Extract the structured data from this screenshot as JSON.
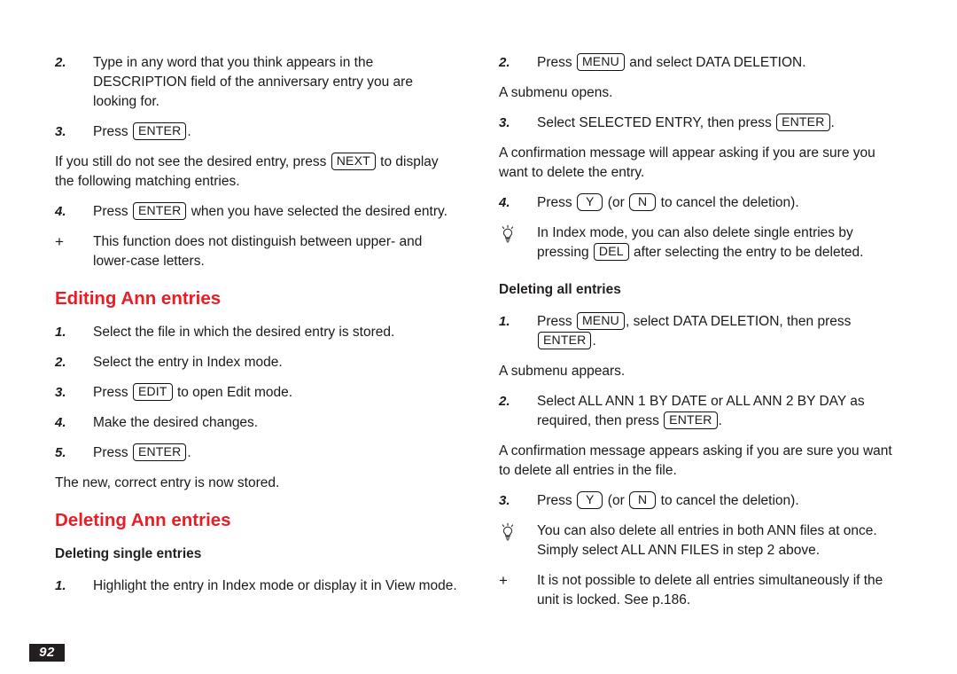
{
  "page": {
    "number": "92",
    "accent_color": "#ec1c24",
    "text_color": "#1a1a1a",
    "background_color": "#ffffff",
    "page_number_box_color": "#231f20"
  },
  "left_column": {
    "step2": {
      "marker": "2.",
      "text": "Type in any word that you think appears in the DESCRIPTION field of the anniversary entry you are looking for."
    },
    "step3": {
      "marker": "3.",
      "before": "Press ",
      "key": "ENTER",
      "after": "."
    },
    "para_next": {
      "before": "If you still do not see the desired entry, press ",
      "key": "NEXT",
      "after": " to display the following matching entries."
    },
    "step4": {
      "marker": "4.",
      "before": "Press ",
      "key": "ENTER",
      "after": " when you have selected the desired entry."
    },
    "note_case": {
      "marker": "+",
      "text": "This function does not distinguish between upper- and lower-case letters."
    },
    "heading_editing": "Editing Ann entries",
    "edit_step1": {
      "marker": "1.",
      "text": "Select the file in which the desired entry is stored."
    },
    "edit_step2": {
      "marker": "2.",
      "text": "Select the entry in Index mode."
    },
    "edit_step3": {
      "marker": "3.",
      "before": "Press ",
      "key": "EDIT",
      "after": " to open Edit mode."
    },
    "edit_step4": {
      "marker": "4.",
      "text": "Make the desired changes."
    },
    "edit_step5": {
      "marker": "5.",
      "before": "Press ",
      "key": "ENTER",
      "after": "."
    },
    "para_stored": "The new, correct entry is now stored.",
    "heading_deleting": "Deleting Ann entries",
    "subheading_single": "Deleting single entries",
    "del_step1": {
      "marker": "1.",
      "text": "Highlight the entry in Index mode or display it in View mode."
    }
  },
  "right_column": {
    "step2": {
      "marker": "2.",
      "before": "Press ",
      "key": "MENU",
      "after": " and select DATA DELETION."
    },
    "para_submenu_opens": "A submenu opens.",
    "step3": {
      "marker": "3.",
      "before": "Select SELECTED ENTRY, then press ",
      "key": "ENTER",
      "after": "."
    },
    "para_confirm_entry": "A confirmation message will appear asking if you are sure you want to delete the entry.",
    "step4": {
      "marker": "4.",
      "before": "Press ",
      "key_yes": "Y",
      "middle": " (or ",
      "key_no": "N",
      "after": " to cancel the deletion)."
    },
    "tip_index_mode": {
      "marker_icon": "lightbulb-icon",
      "before": "In Index mode, you can also delete single entries by pressing ",
      "key": "DEL",
      "after": " after selecting the entry to be deleted."
    },
    "subheading_all": "Deleting all entries",
    "all_step1": {
      "marker": "1.",
      "before": "Press ",
      "key1": "MENU",
      "middle": ", select DATA DELETION, then press ",
      "key2": "ENTER",
      "after": "."
    },
    "para_submenu_appears": "A submenu appears.",
    "all_step2": {
      "marker": "2.",
      "before": "Select ALL ANN 1 BY DATE or ALL ANN 2 BY DAY as required, then press ",
      "key": "ENTER",
      "after": "."
    },
    "para_confirm_all": "A confirmation message appears asking if you are sure you want to delete all entries in the file.",
    "all_step3": {
      "marker": "3.",
      "before": "Press ",
      "key_yes": "Y",
      "middle": " (or ",
      "key_no": "N",
      "after": " to cancel the deletion)."
    },
    "tip_both_files": {
      "marker_icon": "lightbulb-icon",
      "text": "You can also delete all entries in both ANN files at once. Simply select ALL ANN FILES in step 2 above."
    },
    "note_locked": {
      "marker": "+",
      "text": "It is not possible to delete all entries simultaneously if the unit is locked. See p.186."
    }
  }
}
